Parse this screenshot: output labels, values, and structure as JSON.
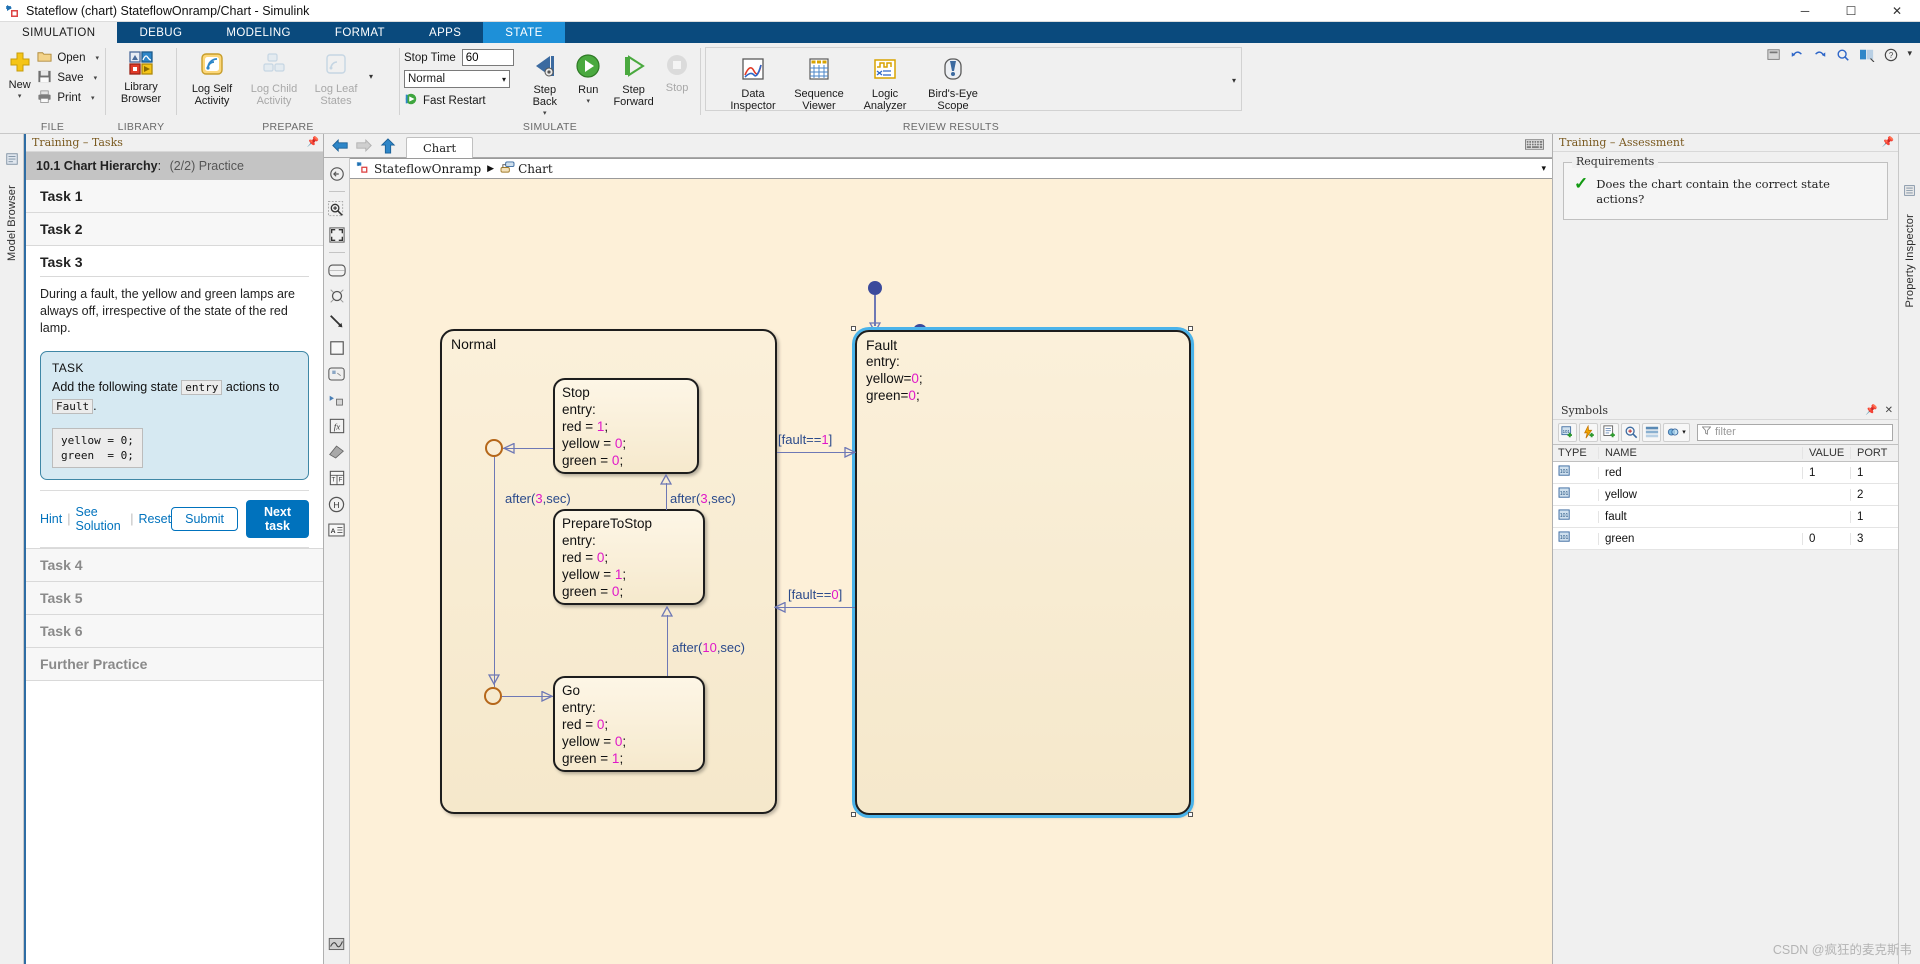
{
  "window": {
    "title": "Stateflow (chart) StateflowOnramp/Chart - Simulink",
    "minimize": "─",
    "maximize": "☐",
    "close": "✕"
  },
  "ribbon": {
    "tabs": [
      {
        "label": "SIMULATION",
        "state": "active-white"
      },
      {
        "label": "DEBUG",
        "state": "normal"
      },
      {
        "label": "MODELING",
        "state": "normal"
      },
      {
        "label": "FORMAT",
        "state": "normal"
      },
      {
        "label": "APPS",
        "state": "normal"
      },
      {
        "label": "STATE",
        "state": "active-blue"
      }
    ],
    "groups": [
      {
        "name": "FILE",
        "label": "FILE",
        "big": [
          {
            "label": "New",
            "icon": "new-plus-icon",
            "caret": true
          }
        ],
        "small": [
          {
            "label": "Open",
            "icon": "folder-icon",
            "caret": true
          },
          {
            "label": "Save",
            "icon": "save-disk-icon",
            "caret": true
          },
          {
            "label": "Print",
            "icon": "printer-icon",
            "caret": true
          }
        ]
      },
      {
        "name": "LIBRARY",
        "label": "LIBRARY",
        "big": [
          {
            "label": "Library\nBrowser",
            "icon": "library-browser-icon",
            "caret": false
          }
        ]
      },
      {
        "name": "PREPARE",
        "label": "PREPARE",
        "big": [
          {
            "label": "Log Self\nActivity",
            "icon": "log-self-activity-icon",
            "enabled": true
          },
          {
            "label": "Log Child\nActivity",
            "icon": "log-child-activity-icon",
            "enabled": false
          },
          {
            "label": "Log Leaf\nStates",
            "icon": "log-leaf-states-icon",
            "enabled": false
          }
        ],
        "overflow_caret": "▾"
      },
      {
        "name": "SIMULATE",
        "label": "SIMULATE",
        "stop_time_label": "Stop Time",
        "stop_time_value": "60",
        "sim_mode": "Normal",
        "fast_restart": "Fast Restart",
        "big": [
          {
            "label": "Step\nBack",
            "icon": "step-back-icon",
            "caret": true
          },
          {
            "label": "Run",
            "icon": "run-icon",
            "caret": true
          },
          {
            "label": "Step\nForward",
            "icon": "step-forward-icon",
            "caret": false
          },
          {
            "label": "Stop",
            "icon": "stop-icon",
            "enabled": false
          }
        ]
      },
      {
        "name": "REVIEW RESULTS",
        "label": "REVIEW RESULTS",
        "big": [
          {
            "label": "Data\nInspector",
            "icon": "data-inspector-icon"
          },
          {
            "label": "Sequence\nViewer",
            "icon": "sequence-viewer-icon"
          },
          {
            "label": "Logic\nAnalyzer",
            "icon": "logic-analyzer-icon"
          },
          {
            "label": "Bird's-Eye\nScope",
            "icon": "birds-eye-scope-icon"
          }
        ],
        "overflow_caret": "▾"
      }
    ],
    "right_icons": [
      "search-icon",
      "undo-icon",
      "redo-icon",
      "zoom-icon",
      "layout-icon",
      "help-icon",
      "more-icon"
    ]
  },
  "left_rail": {
    "items": [
      "Model Browser"
    ]
  },
  "tasks_panel": {
    "header": "Training – Tasks",
    "pin_icon": "pin-icon",
    "current_section": {
      "num": "10.1 Chart Hierarchy",
      "sep": ":",
      "progress": "(2/2) Practice"
    },
    "tasks": [
      {
        "label": "Task 1",
        "state": "collapsed"
      },
      {
        "label": "Task 2",
        "state": "collapsed"
      },
      {
        "label": "Task 3",
        "state": "open"
      },
      {
        "label": "Task 4",
        "state": "collapsed-dim"
      },
      {
        "label": "Task 5",
        "state": "collapsed-dim"
      },
      {
        "label": "Task 6",
        "state": "collapsed-dim"
      },
      {
        "label": "Further Practice",
        "state": "collapsed-dim"
      }
    ],
    "task3": {
      "description": "During a fault, the yellow and green lamps are always off, irrespective of the state of the red lamp.",
      "box_heading": "TASK",
      "box_text_before": "Add the following state",
      "box_code_entry": "entry",
      "box_text_middle": "actions to",
      "box_code_target": "Fault",
      "box_text_after": ".",
      "code_block": "yellow = 0;\ngreen  = 0;",
      "links": [
        "Hint",
        "See Solution",
        "Reset"
      ],
      "submit_label": "Submit",
      "next_label": "Next task"
    }
  },
  "editor": {
    "nav": {
      "back": "back-arrow-icon",
      "forward": "forward-arrow-icon",
      "up": "up-arrow-icon"
    },
    "tab_label": "Chart",
    "keyboard_icon": "keyboard-icon",
    "breadcrumb": [
      {
        "label": "StateflowOnramp",
        "icon": "simulink-model-icon"
      },
      {
        "label": "Chart",
        "icon": "stateflow-chart-icon"
      }
    ],
    "breadcrumb_sep": "▶",
    "breadcrumb_caret": "▾",
    "tools": [
      "fit-to-view-icon",
      "zoom-in-icon",
      "fit-selection-icon",
      "state-icon",
      "junction-icon",
      "transition-icon",
      "box-icon",
      "graphical-function-icon",
      "simulink-function-icon",
      "matlab-function-icon",
      "truth-table-icon",
      "annotation-text-icon",
      "history-junction-icon",
      "textbox-icon",
      "scope-icon"
    ]
  },
  "chart": {
    "default_transitions": 2,
    "states": [
      {
        "id": "normal",
        "name": "Normal",
        "kind": "superstate",
        "selected": false
      },
      {
        "id": "stop",
        "name": "Stop",
        "kind": "state",
        "lines": [
          {
            "text": "entry:"
          },
          {
            "var": "red = ",
            "val": "1",
            "end": ";"
          },
          {
            "var": "yellow = ",
            "val": "0",
            "end": ";"
          },
          {
            "var": "green = ",
            "val": "0",
            "end": ";"
          }
        ]
      },
      {
        "id": "preparetostop",
        "name": "PrepareToStop",
        "kind": "state",
        "lines": [
          {
            "text": "entry:"
          },
          {
            "var": "red = ",
            "val": "0",
            "end": ";"
          },
          {
            "var": "yellow = ",
            "val": "1",
            "end": ";"
          },
          {
            "var": "green = ",
            "val": "0",
            "end": ";"
          }
        ]
      },
      {
        "id": "go",
        "name": "Go",
        "kind": "state",
        "lines": [
          {
            "text": "entry:"
          },
          {
            "var": "red = ",
            "val": "0",
            "end": ";"
          },
          {
            "var": "yellow = ",
            "val": "0",
            "end": ";"
          },
          {
            "var": "green = ",
            "val": "1",
            "end": ";"
          }
        ]
      },
      {
        "id": "fault",
        "name": "Fault",
        "kind": "state",
        "selected": true,
        "lines": [
          {
            "text": "entry:"
          },
          {
            "var": "yellow=",
            "val": "0",
            "end": ";"
          },
          {
            "var": "green=",
            "val": "0",
            "end": ";"
          }
        ]
      }
    ],
    "transitions": [
      {
        "id": "t1",
        "pre": "after(",
        "num": "3",
        "post": ",sec)"
      },
      {
        "id": "t2",
        "pre": "after(",
        "num": "3",
        "post": ",sec)"
      },
      {
        "id": "t3",
        "pre": "after(",
        "num": "10",
        "post": ",sec)"
      },
      {
        "id": "t4",
        "pre": "[fault==",
        "num": "1",
        "post": "]"
      },
      {
        "id": "t5",
        "pre": "[fault==",
        "num": "0",
        "post": "]"
      }
    ]
  },
  "assessment": {
    "header": "Training – Assessment",
    "pin_icon": "pin-icon",
    "legend": "Requirements",
    "check_icon": "green-check-icon",
    "requirement": "Does the chart contain the correct state actions?"
  },
  "symbols": {
    "header": "Symbols",
    "pin_icon": "pin-icon",
    "close_icon": "close-icon",
    "toolbar_buttons": [
      "add-data-icon",
      "add-event-icon",
      "add-message-icon",
      "resolve-undefined-icon",
      "sort-icon",
      "scope-filter-icon"
    ],
    "toolbar_caret": "▾",
    "filter_icon": "filter-icon",
    "filter_placeholder": "filter",
    "columns": [
      "TYPE",
      "NAME",
      "VALUE",
      "PORT"
    ],
    "rows": [
      {
        "type_icon": "data-input-icon",
        "name": "red",
        "value": "1",
        "port": "1"
      },
      {
        "type_icon": "data-input-icon",
        "name": "yellow",
        "value": "",
        "port": "2"
      },
      {
        "type_icon": "data-input-icon",
        "name": "fault",
        "value": "",
        "port": "1"
      },
      {
        "type_icon": "data-input-icon",
        "name": "green",
        "value": "0",
        "port": "3"
      }
    ]
  },
  "right_rail": {
    "items": [
      "Property Inspector"
    ]
  },
  "watermark": "CSDN @疯狂的麦克斯韦"
}
